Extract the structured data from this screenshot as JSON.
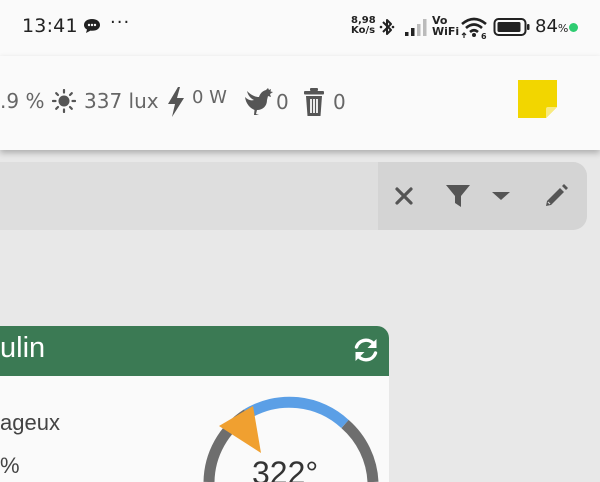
{
  "status_bar": {
    "time": "13:41",
    "more": "···",
    "net_speed_value": "8,98",
    "net_speed_unit": "Ko/s",
    "vowifi_top": "Vo",
    "vowifi_bottom": "WiFi",
    "wifi_sub": "6",
    "battery_percent": "84",
    "battery_percent_sign": "%",
    "dot_color": "#2ecc71"
  },
  "header": {
    "humidity_value": ".9 %",
    "light_value": "337 lux",
    "power_value": "0 W",
    "chicken_value": "0",
    "trash_value": "0",
    "note_color": "#f2d600"
  },
  "filter_bar": {
    "clear_icon": "close-icon",
    "filter_icon": "filter-icon",
    "dropdown_icon": "caret-down-icon",
    "edit_icon": "pencil-icon"
  },
  "card": {
    "title": "ulin",
    "header_color": "#3b7a54",
    "line1": "ageux",
    "line2": "%",
    "gauge_value": "322°",
    "gauge_arc_color": "#5b9fe6",
    "gauge_track_color": "#6e6e6e",
    "pointer_color": "#f0a030"
  }
}
